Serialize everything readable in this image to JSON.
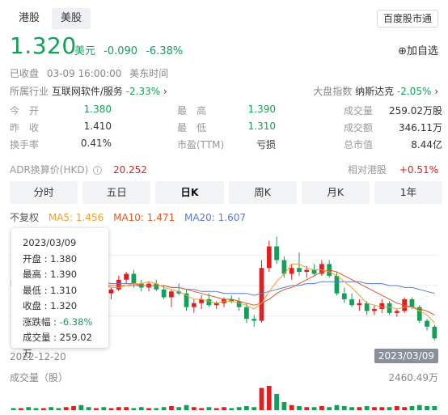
{
  "tabs": [
    "港股",
    "美股"
  ],
  "hk_market_button": "百度股市通",
  "quote": {
    "price": "1.320",
    "currency": "美元",
    "change": "-0.090",
    "change_pct": "-6.38%",
    "follow_label": "⊕加自选"
  },
  "status": {
    "state": "已收盘",
    "time": "03-09 16:00:00",
    "zone": "美东时间"
  },
  "industry": {
    "label": "所属行业",
    "name": "互联网软件/服务",
    "pct": "-2.33%",
    "arrow": "›"
  },
  "market": {
    "label": "大盘指数",
    "name": "纳斯达克",
    "pct": "-2.05%",
    "arrow": "›"
  },
  "stats": [
    [
      {
        "label": "今　开",
        "value": "1.380",
        "color": "green"
      },
      {
        "label": "最　高",
        "value": "1.390",
        "color": "green"
      },
      {
        "label": "成交量",
        "value": "259.02万股",
        "color": "dark"
      }
    ],
    [
      {
        "label": "昨　收",
        "value": "1.410",
        "color": "dark"
      },
      {
        "label": "最　低",
        "value": "1.310",
        "color": "green"
      },
      {
        "label": "成交额",
        "value": "346.11万",
        "color": "dark"
      }
    ],
    [
      {
        "label": "换手率",
        "value": "0.41%",
        "color": "dark"
      },
      {
        "label": "市盈(TTM)",
        "value": "亏损",
        "color": "dark"
      },
      {
        "label": "总市值",
        "value": "8.44亿",
        "color": "dark"
      }
    ]
  ],
  "adr": {
    "label": "ADR换算价(HKD)",
    "info": "i",
    "value": "20.252"
  },
  "hk_rel": {
    "label": "相对港股",
    "value": "+0.51%"
  },
  "periods": [
    "分时",
    "五日",
    "日K",
    "周K",
    "月K",
    "1年"
  ],
  "active_period": "日K",
  "legend": {
    "adjust": "不复权",
    "ma5": "MA5: 1.456",
    "ma10": "MA10: 1.471",
    "ma20": "MA20: 1.607"
  },
  "colors": {
    "up": "#e02020",
    "down": "#14a05a",
    "ma5": "#f0a030",
    "ma10": "#e05a2a",
    "ma20": "#5a7ad0"
  },
  "x_axis": {
    "start": "2022-12-20",
    "end": "2023/03/09",
    "end_tail": "9"
  },
  "volume": {
    "label": "成交量（股）",
    "max": "2460.49万"
  },
  "tooltip": {
    "date": "2023/03/09",
    "open": "开盘 : 1.380",
    "high": "最高 : 1.390",
    "low": "最低 : 1.310",
    "close": "收盘 : 1.320",
    "change_label": "涨跌幅 : ",
    "change_value": "-6.38%",
    "volume": "成交量 : 259.02万"
  },
  "chart_data": {
    "type": "candlestick",
    "candles": [
      {
        "o": 1.62,
        "h": 1.64,
        "l": 1.58,
        "c": 1.59
      },
      {
        "o": 1.59,
        "h": 1.62,
        "l": 1.56,
        "c": 1.61
      },
      {
        "o": 1.61,
        "h": 1.63,
        "l": 1.57,
        "c": 1.58
      },
      {
        "o": 1.58,
        "h": 1.6,
        "l": 1.54,
        "c": 1.56
      },
      {
        "o": 1.56,
        "h": 1.6,
        "l": 1.55,
        "c": 1.59
      },
      {
        "o": 1.59,
        "h": 1.61,
        "l": 1.55,
        "c": 1.57
      },
      {
        "o": 1.57,
        "h": 1.59,
        "l": 1.52,
        "c": 1.55
      },
      {
        "o": 1.55,
        "h": 1.63,
        "l": 1.54,
        "c": 1.62
      },
      {
        "o": 1.62,
        "h": 1.66,
        "l": 1.6,
        "c": 1.63
      },
      {
        "o": 1.63,
        "h": 1.68,
        "l": 1.6,
        "c": 1.61
      },
      {
        "o": 1.61,
        "h": 1.63,
        "l": 1.55,
        "c": 1.56
      },
      {
        "o": 1.56,
        "h": 1.6,
        "l": 1.55,
        "c": 1.59
      },
      {
        "o": 1.59,
        "h": 1.61,
        "l": 1.54,
        "c": 1.55
      },
      {
        "o": 1.55,
        "h": 1.58,
        "l": 1.52,
        "c": 1.57
      },
      {
        "o": 1.57,
        "h": 1.64,
        "l": 1.56,
        "c": 1.62
      },
      {
        "o": 1.62,
        "h": 1.66,
        "l": 1.6,
        "c": 1.65
      },
      {
        "o": 1.65,
        "h": 1.67,
        "l": 1.58,
        "c": 1.6
      },
      {
        "o": 1.6,
        "h": 1.62,
        "l": 1.56,
        "c": 1.58
      },
      {
        "o": 1.58,
        "h": 1.61,
        "l": 1.56,
        "c": 1.6
      },
      {
        "o": 1.6,
        "h": 1.62,
        "l": 1.56,
        "c": 1.57
      },
      {
        "o": 1.57,
        "h": 1.59,
        "l": 1.52,
        "c": 1.53
      },
      {
        "o": 1.53,
        "h": 1.57,
        "l": 1.48,
        "c": 1.56
      },
      {
        "o": 1.56,
        "h": 1.6,
        "l": 1.54,
        "c": 1.55
      },
      {
        "o": 1.55,
        "h": 1.57,
        "l": 1.46,
        "c": 1.48
      },
      {
        "o": 1.48,
        "h": 1.52,
        "l": 1.45,
        "c": 1.5
      },
      {
        "o": 1.5,
        "h": 1.54,
        "l": 1.47,
        "c": 1.52
      },
      {
        "o": 1.52,
        "h": 1.55,
        "l": 1.48,
        "c": 1.49
      },
      {
        "o": 1.49,
        "h": 1.51,
        "l": 1.47,
        "c": 1.5
      },
      {
        "o": 1.5,
        "h": 1.53,
        "l": 1.48,
        "c": 1.52
      },
      {
        "o": 1.52,
        "h": 1.54,
        "l": 1.5,
        "c": 1.51
      },
      {
        "o": 1.51,
        "h": 1.53,
        "l": 1.46,
        "c": 1.48
      },
      {
        "o": 1.48,
        "h": 1.5,
        "l": 1.4,
        "c": 1.42
      },
      {
        "o": 1.42,
        "h": 1.44,
        "l": 1.38,
        "c": 1.41
      },
      {
        "o": 1.41,
        "h": 1.72,
        "l": 1.4,
        "c": 1.68
      },
      {
        "o": 1.68,
        "h": 1.82,
        "l": 1.66,
        "c": 1.79
      },
      {
        "o": 1.79,
        "h": 1.84,
        "l": 1.7,
        "c": 1.72
      },
      {
        "o": 1.72,
        "h": 1.74,
        "l": 1.63,
        "c": 1.65
      },
      {
        "o": 1.65,
        "h": 1.7,
        "l": 1.62,
        "c": 1.68
      },
      {
        "o": 1.68,
        "h": 1.76,
        "l": 1.64,
        "c": 1.66
      },
      {
        "o": 1.66,
        "h": 1.69,
        "l": 1.63,
        "c": 1.67
      },
      {
        "o": 1.67,
        "h": 1.7,
        "l": 1.64,
        "c": 1.65
      },
      {
        "o": 1.65,
        "h": 1.72,
        "l": 1.64,
        "c": 1.7
      },
      {
        "o": 1.7,
        "h": 1.72,
        "l": 1.63,
        "c": 1.64
      },
      {
        "o": 1.64,
        "h": 1.66,
        "l": 1.54,
        "c": 1.55
      },
      {
        "o": 1.55,
        "h": 1.58,
        "l": 1.5,
        "c": 1.52
      },
      {
        "o": 1.52,
        "h": 1.55,
        "l": 1.48,
        "c": 1.49
      },
      {
        "o": 1.49,
        "h": 1.52,
        "l": 1.46,
        "c": 1.5
      },
      {
        "o": 1.5,
        "h": 1.51,
        "l": 1.44,
        "c": 1.46
      },
      {
        "o": 1.46,
        "h": 1.49,
        "l": 1.44,
        "c": 1.47
      },
      {
        "o": 1.47,
        "h": 1.52,
        "l": 1.45,
        "c": 1.5
      },
      {
        "o": 1.5,
        "h": 1.51,
        "l": 1.44,
        "c": 1.45
      },
      {
        "o": 1.45,
        "h": 1.47,
        "l": 1.43,
        "c": 1.46
      },
      {
        "o": 1.46,
        "h": 1.53,
        "l": 1.45,
        "c": 1.52
      },
      {
        "o": 1.52,
        "h": 1.53,
        "l": 1.47,
        "c": 1.48
      },
      {
        "o": 1.48,
        "h": 1.49,
        "l": 1.4,
        "c": 1.41
      },
      {
        "o": 1.41,
        "h": 1.42,
        "l": 1.36,
        "c": 1.38
      },
      {
        "o": 1.38,
        "h": 1.39,
        "l": 1.31,
        "c": 1.32
      }
    ],
    "ma5": [
      1.6,
      1.59,
      1.59,
      1.58,
      1.58,
      1.58,
      1.57,
      1.58,
      1.59,
      1.6,
      1.59,
      1.59,
      1.59,
      1.58,
      1.58,
      1.59,
      1.6,
      1.6,
      1.61,
      1.6,
      1.58,
      1.57,
      1.56,
      1.54,
      1.52,
      1.52,
      1.51,
      1.5,
      1.51,
      1.51,
      1.5,
      1.49,
      1.47,
      1.5,
      1.56,
      1.61,
      1.65,
      1.7,
      1.7,
      1.68,
      1.67,
      1.67,
      1.66,
      1.64,
      1.61,
      1.58,
      1.54,
      1.5,
      1.49,
      1.48,
      1.48,
      1.47,
      1.48,
      1.48,
      1.46,
      1.44,
      1.4
    ],
    "ma10": [
      1.62,
      1.61,
      1.61,
      1.6,
      1.6,
      1.59,
      1.59,
      1.59,
      1.59,
      1.59,
      1.59,
      1.59,
      1.59,
      1.59,
      1.59,
      1.59,
      1.59,
      1.59,
      1.59,
      1.59,
      1.59,
      1.58,
      1.58,
      1.57,
      1.56,
      1.55,
      1.54,
      1.53,
      1.52,
      1.52,
      1.51,
      1.5,
      1.49,
      1.5,
      1.52,
      1.55,
      1.57,
      1.58,
      1.6,
      1.62,
      1.64,
      1.66,
      1.67,
      1.66,
      1.64,
      1.62,
      1.6,
      1.58,
      1.56,
      1.54,
      1.52,
      1.5,
      1.49,
      1.48,
      1.47,
      1.46,
      1.44
    ],
    "ma20": [
      1.66,
      1.66,
      1.65,
      1.65,
      1.64,
      1.64,
      1.63,
      1.63,
      1.62,
      1.62,
      1.61,
      1.61,
      1.61,
      1.6,
      1.6,
      1.6,
      1.6,
      1.59,
      1.59,
      1.59,
      1.59,
      1.58,
      1.58,
      1.57,
      1.57,
      1.56,
      1.56,
      1.56,
      1.55,
      1.55,
      1.55,
      1.55,
      1.54,
      1.55,
      1.56,
      1.57,
      1.58,
      1.59,
      1.59,
      1.6,
      1.6,
      1.61,
      1.61,
      1.61,
      1.61,
      1.61,
      1.61,
      1.6,
      1.6,
      1.6,
      1.59,
      1.59,
      1.58,
      1.58,
      1.57,
      1.56,
      1.55
    ],
    "volumes": [
      2,
      2,
      3,
      2,
      2,
      3,
      2,
      3,
      4,
      5,
      3,
      2,
      3,
      2,
      3,
      3,
      2,
      3,
      2,
      2,
      3,
      4,
      3,
      5,
      3,
      2,
      3,
      2,
      3,
      2,
      3,
      4,
      3,
      22,
      24,
      16,
      8,
      5,
      4,
      3,
      3,
      4,
      3,
      5,
      4,
      3,
      3,
      4,
      3,
      3,
      3,
      4,
      3,
      4,
      5,
      4,
      4
    ],
    "ylim": [
      1.28,
      1.9
    ]
  }
}
